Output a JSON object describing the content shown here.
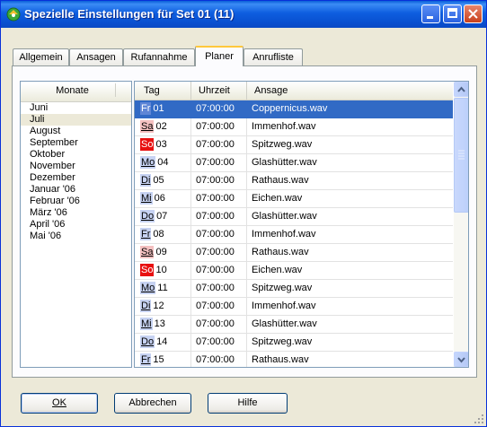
{
  "window": {
    "title": "Spezielle Einstellungen für Set 01 (11)",
    "title_icon": "app-disc-icon",
    "controls": [
      "minimize-icon",
      "maximize-icon",
      "close-icon"
    ]
  },
  "tabs": [
    {
      "label": "Allgemein"
    },
    {
      "label": "Ansagen"
    },
    {
      "label": "Rufannahme"
    },
    {
      "label": "Planer"
    },
    {
      "label": "Anrufliste"
    }
  ],
  "active_tab": "Planer",
  "months": {
    "header": "Monate",
    "items": [
      "Juni",
      "Juli",
      "August",
      "September",
      "Oktober",
      "November",
      "Dezember",
      "Januar '06",
      "Februar '06",
      "März '06",
      "April '06",
      "Mai '06"
    ],
    "selected": "Juli"
  },
  "schedule": {
    "headers": {
      "tag": "Tag",
      "uhrzeit": "Uhrzeit",
      "ansage": "Ansage"
    },
    "rows": [
      {
        "day": "Fr",
        "num": "01",
        "time": "07:00:00",
        "ansage": "Coppernicus.wav"
      },
      {
        "day": "Sa",
        "num": "02",
        "time": "07:00:00",
        "ansage": "Immenhof.wav"
      },
      {
        "day": "So",
        "num": "03",
        "time": "07:00:00",
        "ansage": "Spitzweg.wav"
      },
      {
        "day": "Mo",
        "num": "04",
        "time": "07:00:00",
        "ansage": "Glashütter.wav"
      },
      {
        "day": "Di",
        "num": "05",
        "time": "07:00:00",
        "ansage": "Rathaus.wav"
      },
      {
        "day": "Mi",
        "num": "06",
        "time": "07:00:00",
        "ansage": "Eichen.wav"
      },
      {
        "day": "Do",
        "num": "07",
        "time": "07:00:00",
        "ansage": "Glashütter.wav"
      },
      {
        "day": "Fr",
        "num": "08",
        "time": "07:00:00",
        "ansage": "Immenhof.wav"
      },
      {
        "day": "Sa",
        "num": "09",
        "time": "07:00:00",
        "ansage": "Rathaus.wav"
      },
      {
        "day": "So",
        "num": "10",
        "time": "07:00:00",
        "ansage": "Eichen.wav"
      },
      {
        "day": "Mo",
        "num": "11",
        "time": "07:00:00",
        "ansage": "Spitzweg.wav"
      },
      {
        "day": "Di",
        "num": "12",
        "time": "07:00:00",
        "ansage": "Immenhof.wav"
      },
      {
        "day": "Mi",
        "num": "13",
        "time": "07:00:00",
        "ansage": "Glashütter.wav"
      },
      {
        "day": "Do",
        "num": "14",
        "time": "07:00:00",
        "ansage": "Spitzweg.wav"
      },
      {
        "day": "Fr",
        "num": "15",
        "time": "07:00:00",
        "ansage": "Rathaus.wav"
      }
    ],
    "selected_row": 0
  },
  "buttons": {
    "ok": "OK",
    "cancel": "Abbrechen",
    "help": "Hilfe"
  },
  "colors": {
    "title_bar": "#0a5fd8",
    "selection": "#316ac5",
    "sunday": "#e81010",
    "saturday": "#f4c0c0",
    "weekday": "#c6d2f2"
  }
}
